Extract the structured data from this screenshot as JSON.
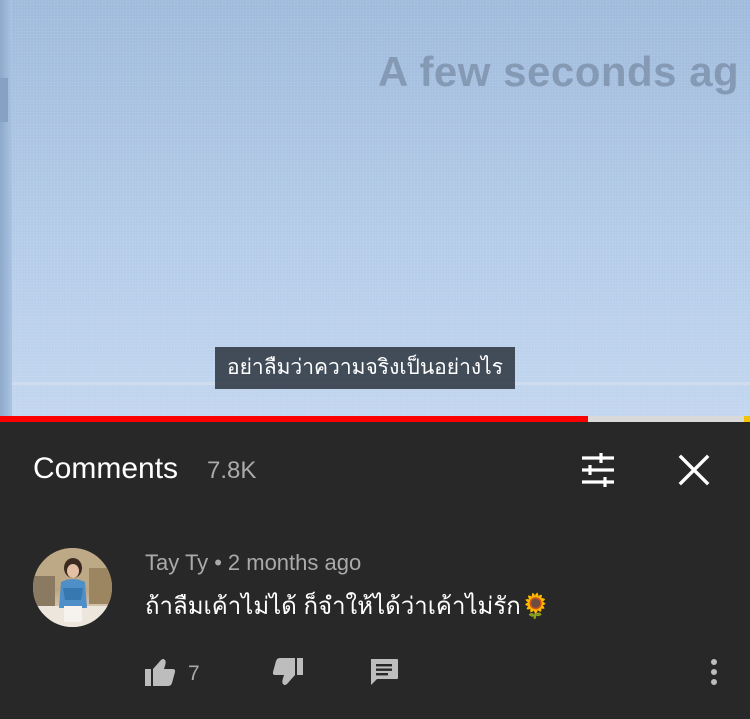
{
  "video": {
    "screen_text": "A few seconds ag",
    "caption": "อย่าลืมว่าความจริงเป็นอย่างไร",
    "progress_fraction": 0.784
  },
  "comments_panel": {
    "title": "Comments",
    "count": "7.8K",
    "icons": {
      "filter": "sort-filter-icon",
      "close": "close-icon"
    }
  },
  "comment": {
    "author": "Tay Ty",
    "separator": "•",
    "time": "2 months ago",
    "text": "ถ้าลืมเค้าไม่ได้ ก็จำให้ได้ว่าเค้าไม่รัก🌻",
    "like_count": "7",
    "icons": {
      "like": "thumbs-up-icon",
      "dislike": "thumbs-down-icon",
      "reply": "reply-comment-icon",
      "more": "more-vert-icon"
    }
  },
  "colors": {
    "panel_bg": "#282828",
    "progress_played": "#ff0000",
    "secondary_text": "#aaaaaa",
    "primary_text": "#ffffff"
  }
}
